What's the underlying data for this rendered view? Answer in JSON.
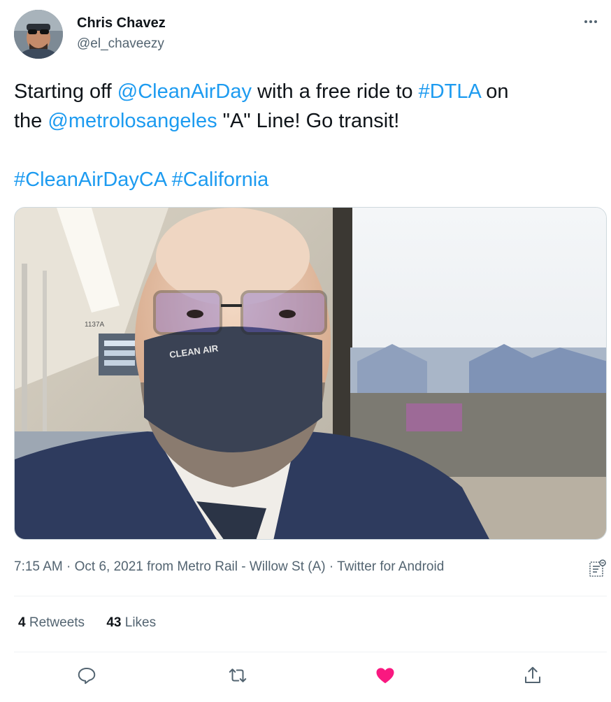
{
  "author": {
    "name": "Chris Chavez",
    "handle": "@el_chaveezy"
  },
  "tweet": {
    "line1_prefix": "Starting off ",
    "mention1": "@CleanAirDay",
    "line1_middle": " with a free ride to ",
    "hashtag1": "#DTLA",
    "line1_suffix": " on",
    "line2_prefix": "the ",
    "mention2": "@metrolosangeles",
    "line2_suffix": " \"A\" Line! Go transit!",
    "hashtag2": "#CleanAirDayCA",
    "hashtag3": "#California"
  },
  "media": {
    "train_number": "1137A",
    "mask_text": "CLEAN AIR"
  },
  "meta": {
    "time": "7:15 AM",
    "separator": " · ",
    "date": "Oct 6, 2021",
    "from_label": " from ",
    "location": "Metro Rail - Willow St (A)",
    "source": "Twitter for Android"
  },
  "stats": {
    "retweets_count": "4",
    "retweets_label": " Retweets",
    "likes_count": "43",
    "likes_label": " Likes"
  },
  "colors": {
    "link": "#1d9bf0",
    "secondary_text": "#536471",
    "like_active": "#f91880"
  },
  "icons": {
    "reply": "reply-icon",
    "retweet": "retweet-icon",
    "like": "heart-icon",
    "share": "share-icon",
    "more": "more-icon",
    "analytics": "analytics-icon"
  }
}
